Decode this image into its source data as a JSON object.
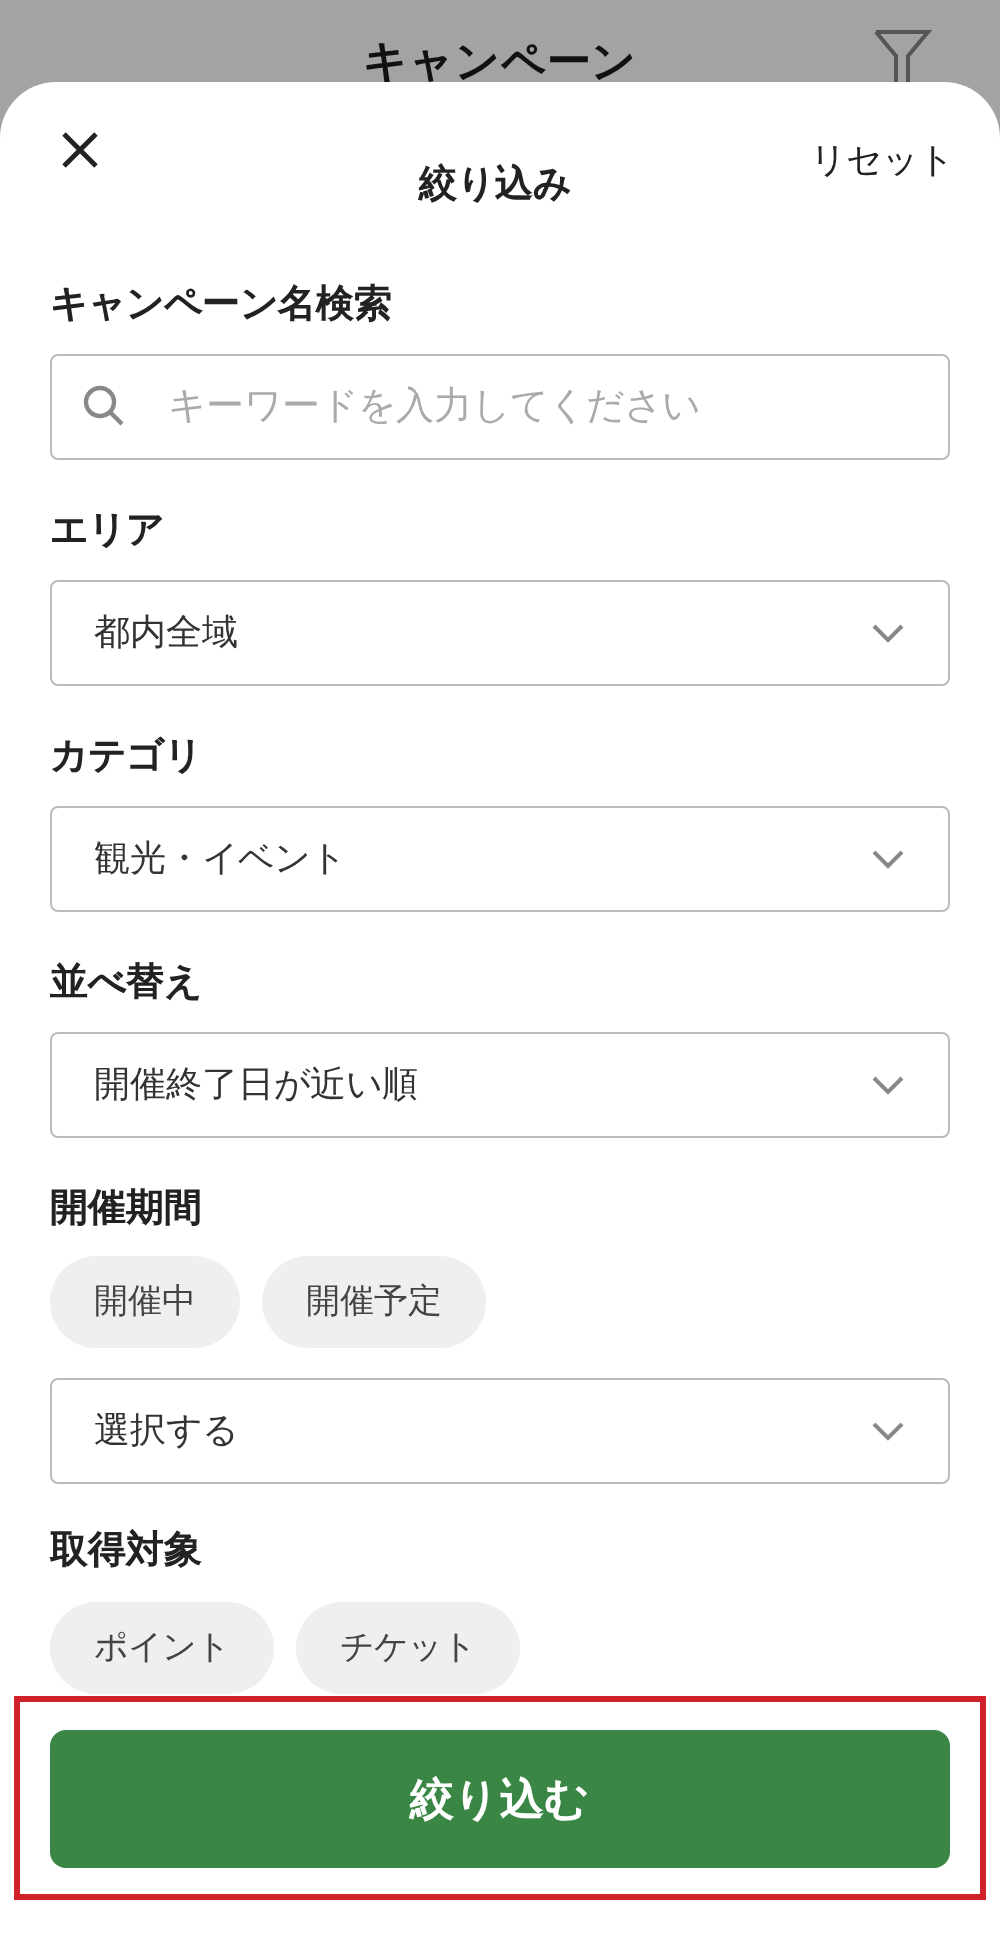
{
  "background": {
    "title": "キャンペーン"
  },
  "sheet": {
    "title": "絞り込み",
    "reset": "リセット"
  },
  "search": {
    "label": "キャンペーン名検索",
    "placeholder": "キーワードを入力してください"
  },
  "selects": [
    {
      "label": "エリア",
      "value": "都内全域"
    },
    {
      "label": "カテゴリ",
      "value": "観光・イベント"
    },
    {
      "label": "並べ替え",
      "value": "開催終了日が近い順"
    }
  ],
  "period": {
    "label": "開催期間",
    "chips": [
      {
        "label": "開催中",
        "selected": false
      },
      {
        "label": "開催予定",
        "selected": false
      }
    ],
    "select": "選択する"
  },
  "target": {
    "label": "取得対象",
    "chips": [
      {
        "label": "ポイント",
        "selected": false
      },
      {
        "label": "チケット",
        "selected": false
      }
    ]
  },
  "submit": "絞り込む"
}
